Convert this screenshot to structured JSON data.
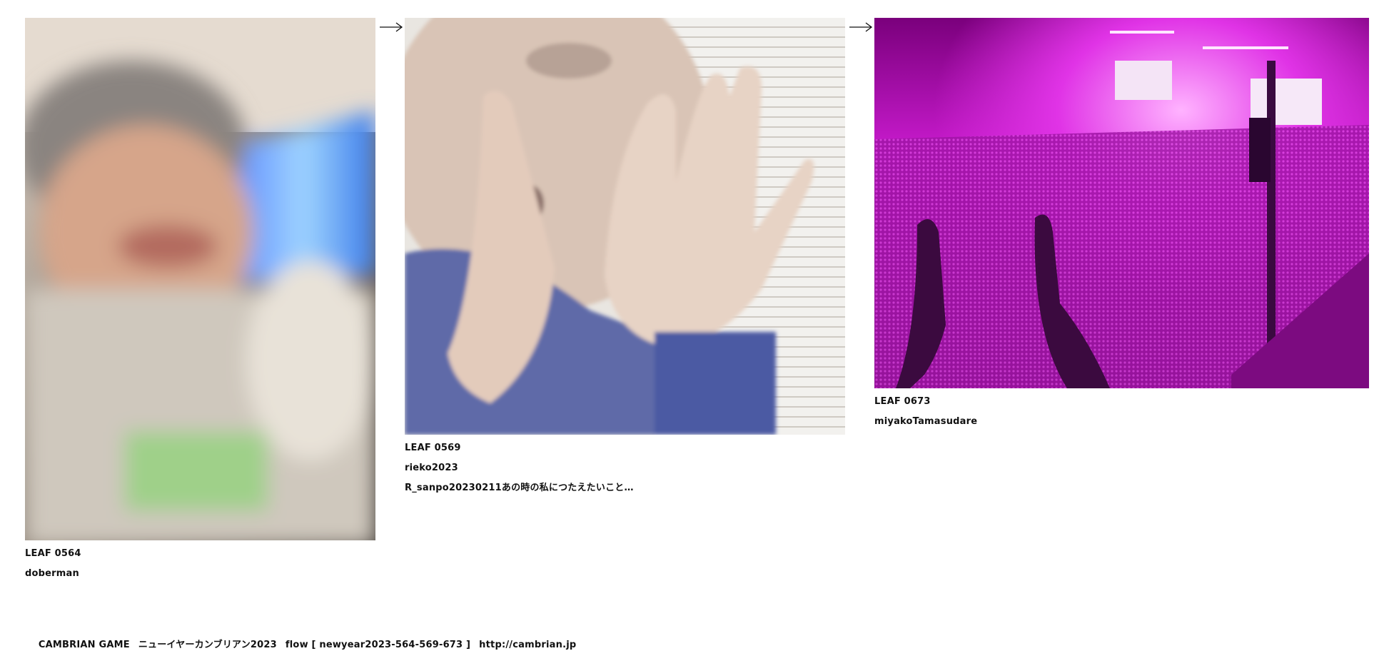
{
  "leaves": [
    {
      "leaf_id": "LEAF 0564",
      "user": "doberman",
      "note": ""
    },
    {
      "leaf_id": "LEAF 0569",
      "user": "rieko2023",
      "note": "R_sanpo20230211あの時の私につたえたいこと…"
    },
    {
      "leaf_id": "LEAF 0673",
      "user": "miyakoTamasudare",
      "note": ""
    }
  ],
  "footer": {
    "brand": "CAMBRIAN GAME",
    "event": "ニューイヤーカンブリアン2023",
    "flow": "flow [ newyear2023-564-569-673 ]",
    "url": "http://cambrian.jp"
  },
  "icons": {
    "flow_arrow": "right-arrow-icon"
  }
}
